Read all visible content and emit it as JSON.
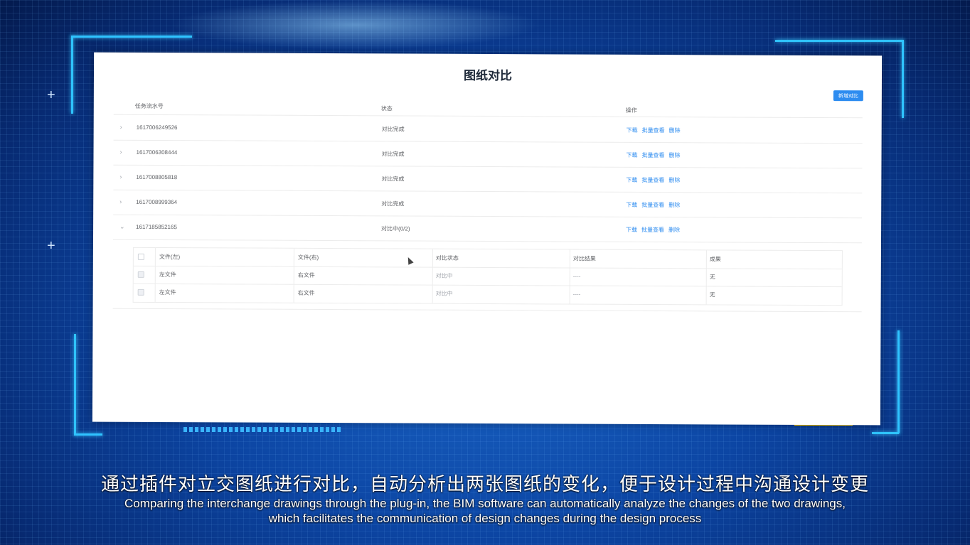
{
  "panel": {
    "title": "图纸对比",
    "new_button": "新增对比",
    "columns": {
      "serial": "任务流水号",
      "status": "状态",
      "actions": "操作"
    },
    "action_labels": {
      "download": "下载",
      "batch_view": "批量查看",
      "delete": "删除"
    },
    "rows": [
      {
        "id": "1617006249526",
        "status": "对比完成",
        "expanded": false
      },
      {
        "id": "1617006308444",
        "status": "对比完成",
        "expanded": false
      },
      {
        "id": "1617008805818",
        "status": "对比完成",
        "expanded": false
      },
      {
        "id": "1617008999364",
        "status": "对比完成",
        "expanded": false
      },
      {
        "id": "1617185852165",
        "status": "对比中(0/2)",
        "expanded": true
      }
    ],
    "sub_table": {
      "columns": {
        "left": "文件(左)",
        "right": "文件(右)",
        "state": "对比状态",
        "result": "对比结果",
        "output": "成果"
      },
      "rows": [
        {
          "left": "左文件",
          "right": "右文件",
          "state": "对比中",
          "result": "----",
          "output": "无"
        },
        {
          "left": "左文件",
          "right": "右文件",
          "state": "对比中",
          "result": "----",
          "output": "无"
        }
      ]
    }
  },
  "subtitles": {
    "zh": "通过插件对立交图纸进行对比，自动分析出两张图纸的变化，便于设计过程中沟通设计变更",
    "en_line1": "Comparing the interchange drawings through the plug-in, the BIM software can automatically analyze the changes of the two drawings,",
    "en_line2": "which facilitates the communication of design changes during the design process"
  },
  "colors": {
    "accent": "#2d8cf0",
    "frame": "#2fc3ff",
    "highlight": "#f5c400"
  }
}
